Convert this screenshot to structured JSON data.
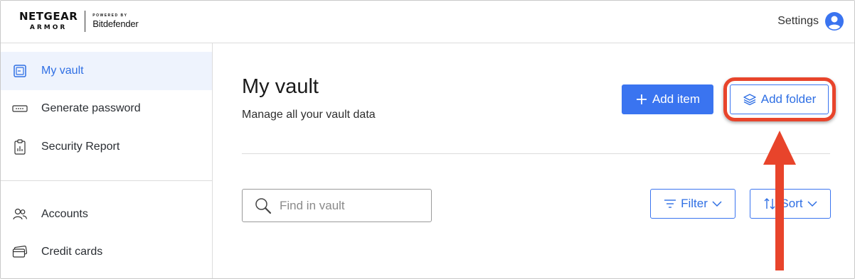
{
  "header": {
    "logo_netgear": "NETGEAR",
    "logo_armor": "ARMOR",
    "logo_powered_by": "POWERED BY",
    "logo_bitdefender": "Bitdefender",
    "settings_label": "Settings"
  },
  "sidebar": {
    "items": [
      {
        "label": "My vault",
        "icon": "vault-icon",
        "active": true
      },
      {
        "label": "Generate password",
        "icon": "password-field-icon",
        "active": false
      },
      {
        "label": "Security Report",
        "icon": "clipboard-chart-icon",
        "active": false
      },
      {
        "label": "Accounts",
        "icon": "users-icon",
        "active": false
      },
      {
        "label": "Credit cards",
        "icon": "credit-cards-icon",
        "active": false
      }
    ]
  },
  "main": {
    "title": "My vault",
    "subtitle": "Manage all your vault data",
    "add_item_label": "Add item",
    "add_folder_label": "Add folder",
    "search_placeholder": "Find in vault",
    "filter_label": "Filter",
    "sort_label": "Sort"
  },
  "annotation": {
    "highlight_target": "Add folder",
    "highlight_color": "#e8442b"
  },
  "colors": {
    "accent": "#3a74f0",
    "active_bg": "#eef3fd",
    "active_text": "#2f6fe4"
  }
}
